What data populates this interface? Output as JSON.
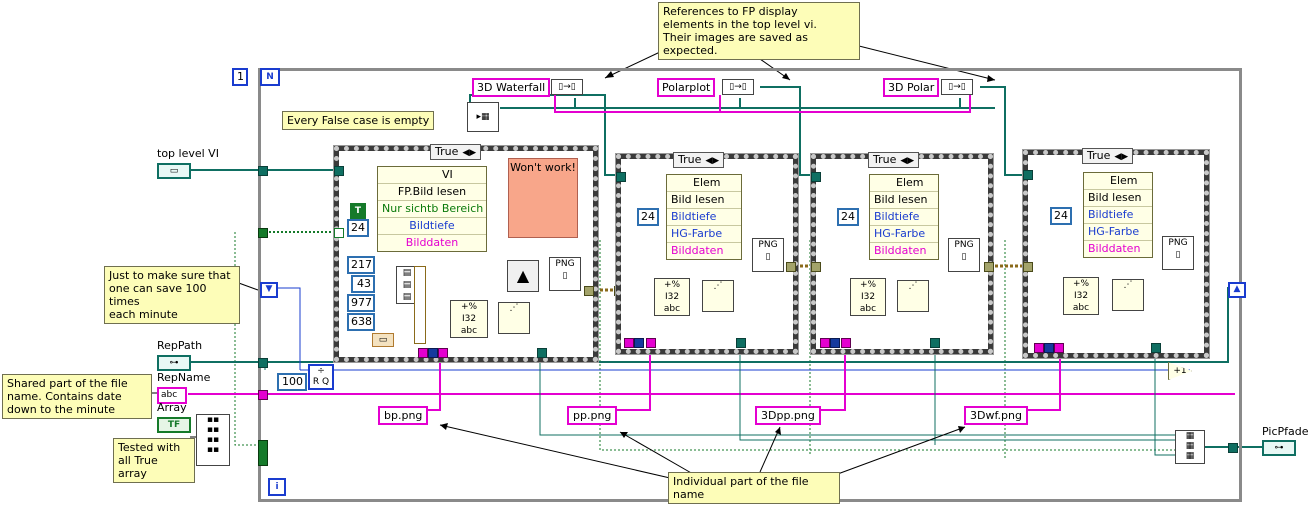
{
  "loop": {
    "count_terminal": "N",
    "iteration_terminal": "i",
    "count_value": "1"
  },
  "notes": {
    "references": "References to FP display\nelements in the top level vi.\nTheir images are saved as expected.",
    "false_case": "Every False case is empty",
    "just_to_make_sure": "Just to make sure that\none can save 100 times\neach minute",
    "shared_part": "Shared part of the file\nname. Contains date\ndown to the minute",
    "tested_with": "Tested with\nall True array",
    "individual_part": "Individual part of the file name",
    "wont_work": "Won't work!"
  },
  "refs": [
    "3D Waterfall",
    "Polarplot",
    "3D Polar"
  ],
  "controls": {
    "top_level_vi": "top level VI",
    "rep_path": "RepPath",
    "rep_name": "RepName",
    "array": "Array",
    "pic_pfade": "PicPfade",
    "abc_glyph": "abc",
    "tf_glyph": "TF"
  },
  "case_selector": "True",
  "first_node": {
    "header": "VI",
    "method": "FP.Bild lesen",
    "params": [
      "Nur sichtb Bereich",
      "Bildtiefe",
      "Bilddaten"
    ]
  },
  "elem_node": {
    "header": "Elem",
    "method": "Bild lesen",
    "params": [
      "Bildtiefe",
      "HG-Farbe",
      "Bilddaten"
    ]
  },
  "constants": {
    "depth": "24",
    "bool_t": "T",
    "c217": "217",
    "c43": "43",
    "c977": "977",
    "c638": "638",
    "c100": "100",
    "plus_one": "+1",
    "png": "PNG"
  },
  "filenames": [
    "bp.png",
    "pp.png",
    "3Dpp.png",
    "3Dwf.png"
  ]
}
